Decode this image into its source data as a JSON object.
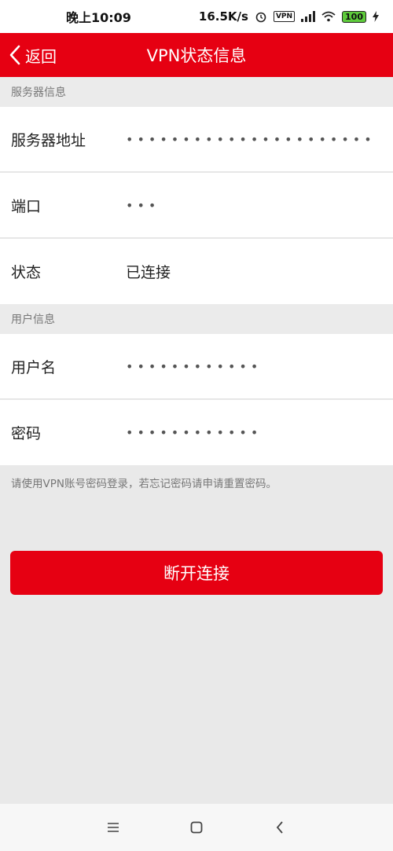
{
  "status_bar": {
    "time": "晚上10:09",
    "speed": "16.5K/s",
    "vpn_badge": "VPN",
    "battery": "100"
  },
  "header": {
    "back_label": "返回",
    "title": "VPN状态信息"
  },
  "sections": {
    "server": "服务器信息",
    "user": "用户信息"
  },
  "server_rows": [
    {
      "label": "服务器地址",
      "value": "••••••••••••••••••••••"
    },
    {
      "label": "端口",
      "value": "•••"
    },
    {
      "label": "状态",
      "value": "已连接"
    }
  ],
  "user_rows": [
    {
      "label": "用户名",
      "value": "••••••••••••"
    },
    {
      "label": "密码",
      "value": "••••••••••••"
    }
  ],
  "note": "请使用VPN账号密码登录，若忘记密码请申请重置密码。",
  "action": {
    "disconnect_label": "断开连接"
  },
  "nav_icons": [
    "menu-icon",
    "home-icon",
    "back-icon"
  ],
  "colors": {
    "brand_red": "#e60012",
    "background": "#e9e9e9"
  }
}
